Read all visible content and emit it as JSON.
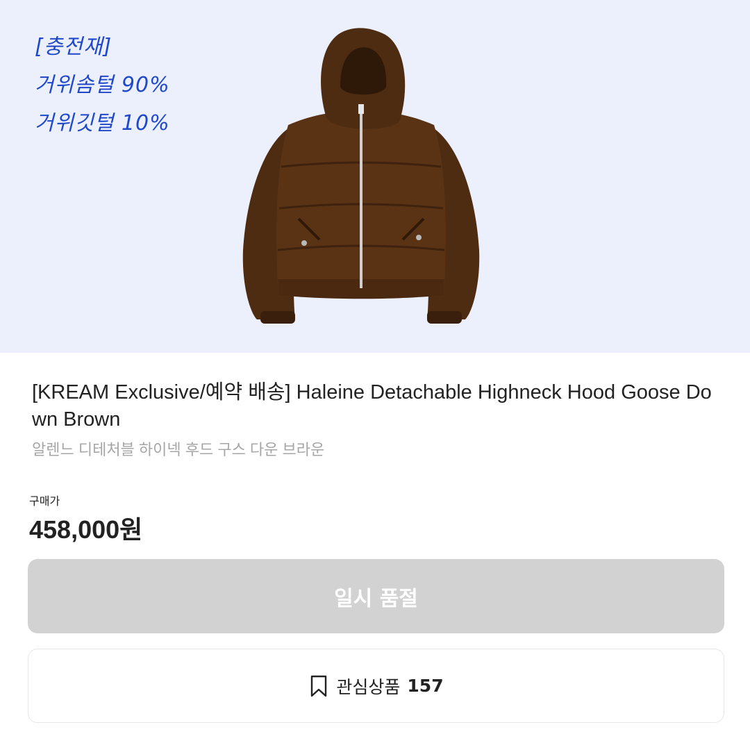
{
  "hero": {
    "background": "#eceffc",
    "notes": [
      "[충전재]",
      "거위솜털 90%",
      "거위깃털 10%"
    ],
    "note_color": "#1f49c9",
    "image": "brown-down-jacket"
  },
  "product": {
    "title": "[KREAM Exclusive/예약 배송] Haleine Detachable Highneck Hood Goose Down Brown",
    "subtitle": "알렌느 디테처블 하이넥 후드 구스 다운 브라운"
  },
  "price": {
    "label": "구매가",
    "value": "458,000원"
  },
  "buttons": {
    "soldout_label": "일시 품절",
    "wishlist_label": "관심상품",
    "wishlist_count": "157"
  }
}
